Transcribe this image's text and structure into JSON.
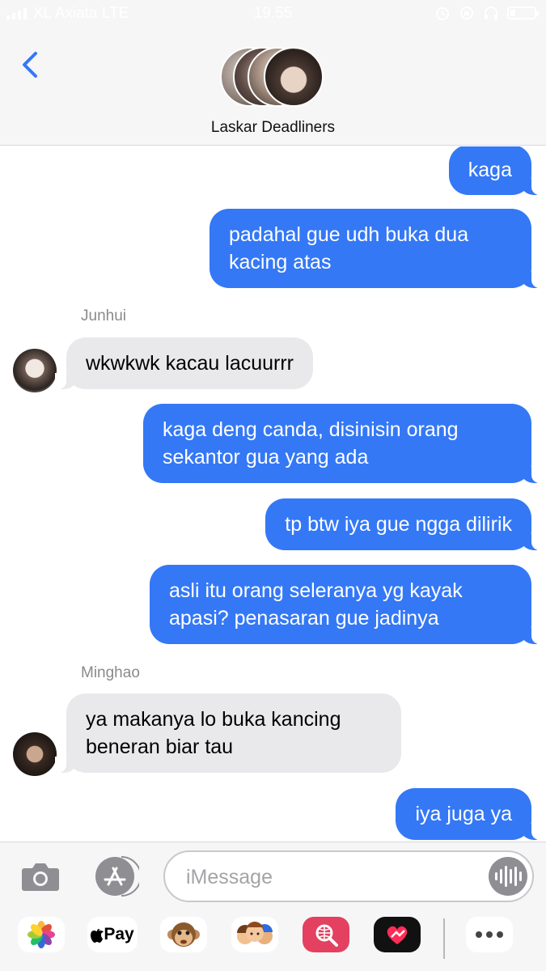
{
  "status_bar": {
    "carrier": "XL Axiata LTE",
    "time": "19.55"
  },
  "header": {
    "group_name": "Laskar Deadliners",
    "back_icon": "chevron-left-icon"
  },
  "messages": [
    {
      "type": "out",
      "text": "kaga"
    },
    {
      "type": "out",
      "lines": [
        "padahal gue udh buka dua",
        "kacing atas"
      ]
    },
    {
      "type": "in",
      "sender": "Junhui",
      "text": "wkwkwk kacau lacuurrr"
    },
    {
      "type": "out",
      "lines": [
        "kaga deng canda, disinisin orang",
        "sekantor gua yang ada"
      ]
    },
    {
      "type": "out",
      "text": "tp btw iya gue ngga dilirik"
    },
    {
      "type": "out",
      "lines": [
        "asli itu orang seleranya yg kayak",
        "apasi? penasaran gue jadinya"
      ]
    },
    {
      "type": "in",
      "sender": "Minghao",
      "lines": [
        "ya makanya lo buka kancing",
        "beneran biar tau"
      ]
    },
    {
      "type": "out",
      "text": "iya juga ya"
    }
  ],
  "composer": {
    "placeholder": "iMessage",
    "camera_icon": "camera-icon",
    "appstore_icon": "appstore-icon",
    "audio_icon": "audio-waveform-icon"
  },
  "app_drawer": {
    "apple_pay_label": "Pay",
    "icons": [
      "photos-icon",
      "apple-pay-icon",
      "monkey-emoji-icon",
      "memoji-icon",
      "web-search-icon",
      "digital-touch-icon",
      "more-icon"
    ]
  },
  "colors": {
    "outgoing_bubble": "#3478f6",
    "incoming_bubble": "#e9e9eb",
    "header_bg": "#f6f6f7"
  }
}
